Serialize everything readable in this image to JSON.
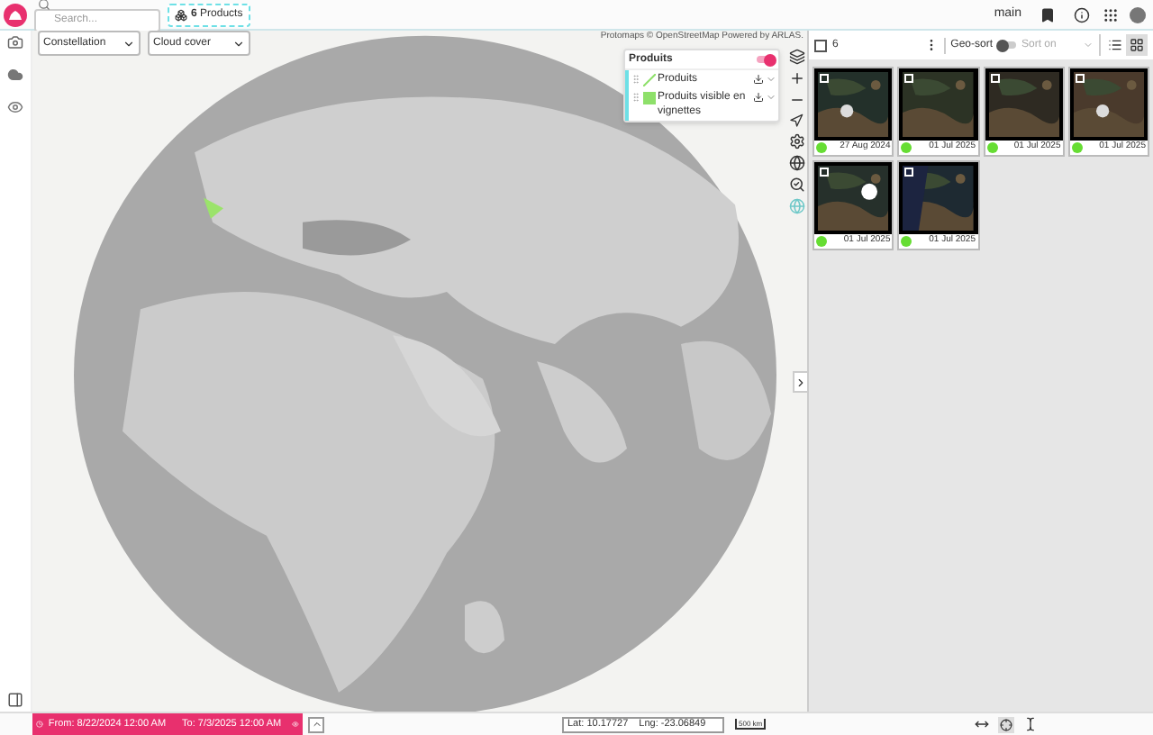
{
  "search": {
    "placeholder": "Search..."
  },
  "products_button": {
    "count": "6",
    "label": "Products"
  },
  "header": {
    "workspace": "main"
  },
  "filters": [
    {
      "label": "Constellation"
    },
    {
      "label": "Cloud cover"
    }
  ],
  "map": {
    "attribution": "Protomaps © OpenStreetMap Powered by ARLAS."
  },
  "layers_panel": {
    "title": "Produits",
    "on": true,
    "layers": [
      {
        "label": "Produits"
      },
      {
        "label": "Produits visible en vignettes"
      }
    ]
  },
  "results": {
    "count": "6",
    "select_all": false,
    "geo_sort_label": "Geo-sort",
    "geo_sort_on": false,
    "sort_placeholder": "Sort on",
    "view_modes": [
      {
        "kind": "list",
        "selected": false
      },
      {
        "kind": "grid",
        "selected": true
      }
    ]
  },
  "tiles": [
    {
      "date": "27 Aug 2024",
      "checked": false,
      "color": "#66dd33"
    },
    {
      "date": "01 Jul 2025",
      "checked": false,
      "color": "#66dd33"
    },
    {
      "date": "01 Jul 2025",
      "checked": false,
      "color": "#66dd33"
    },
    {
      "date": "01 Jul 2025",
      "checked": false,
      "color": "#66dd33"
    },
    {
      "date": "01 Jul 2025",
      "checked": false,
      "color": "#66dd33"
    },
    {
      "date": "01 Jul 2025",
      "checked": false,
      "color": "#66dd33"
    }
  ],
  "time_range": {
    "from": "From: 8/22/2024 12:00 AM",
    "to": "To: 7/3/2025 12:00 AM"
  },
  "coordinates": {
    "lat": "Lat: 10.17727",
    "lng": "Lng: -23.06849"
  },
  "scale": {
    "label": "500 km"
  }
}
